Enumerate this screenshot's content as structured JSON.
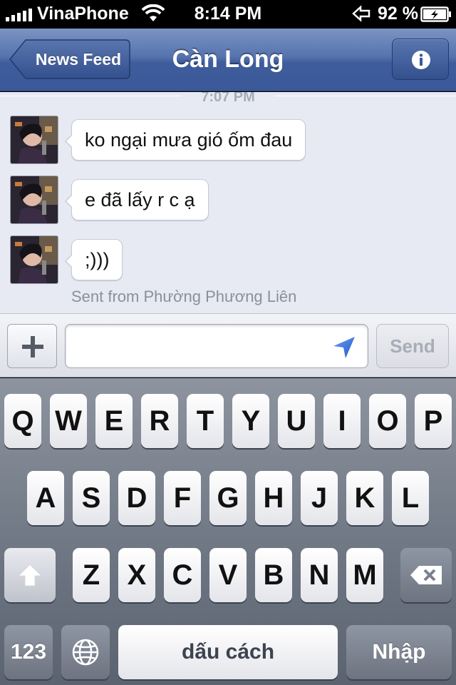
{
  "status_bar": {
    "carrier": "VinaPhone",
    "time": "8:14 PM",
    "battery": "92 %"
  },
  "nav": {
    "back_label": "News Feed",
    "title": "Càn Long",
    "info_icon": "info-icon"
  },
  "chat": {
    "timestamp": "7:07 PM",
    "messages": [
      {
        "text": "ko ngại mưa gió ốm đau"
      },
      {
        "text": "e đã lấy r c ạ"
      },
      {
        "text": ";)))"
      }
    ],
    "sent_from": "Sent from Phường Phương Liên"
  },
  "composer": {
    "input_value": "",
    "send_label": "Send",
    "plus_icon": "plus-icon",
    "location_icon": "location-arrow-icon"
  },
  "keyboard": {
    "row1": [
      "Q",
      "W",
      "E",
      "R",
      "T",
      "Y",
      "U",
      "I",
      "O",
      "P"
    ],
    "row2": [
      "A",
      "S",
      "D",
      "F",
      "G",
      "H",
      "J",
      "K",
      "L"
    ],
    "row3": [
      "Z",
      "X",
      "C",
      "V",
      "B",
      "N",
      "M"
    ],
    "numbers_label": "123",
    "space_label": "dấu cách",
    "return_label": "Nhập",
    "shift_icon": "shift-icon",
    "globe_icon": "globe-icon",
    "delete_icon": "delete-icon"
  },
  "colors": {
    "nav_blue": "#3b5998",
    "chat_bg": "#e7eaf2",
    "send_disabled": "#a8adb7"
  }
}
